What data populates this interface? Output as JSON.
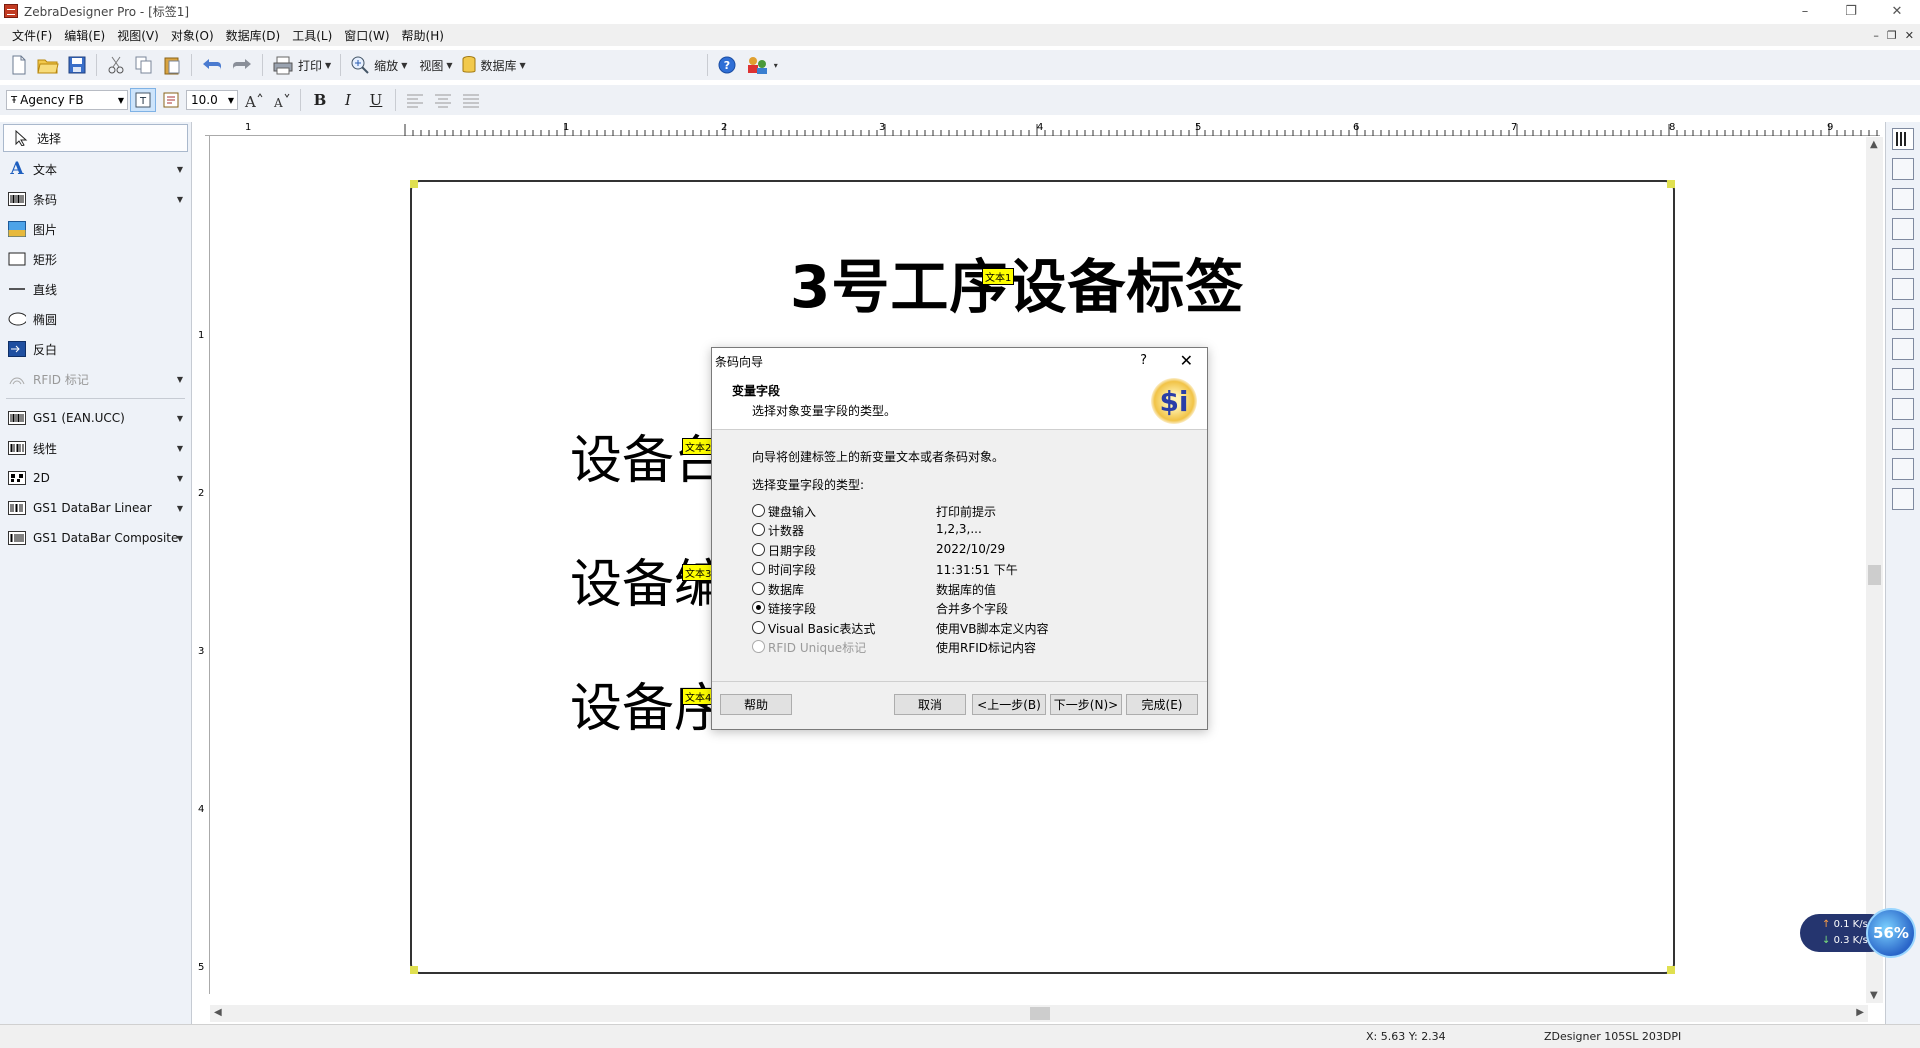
{
  "window": {
    "title": "ZebraDesigner Pro - [标签1]",
    "controls": [
      "–",
      "❐",
      "✕"
    ]
  },
  "menu": [
    "文件(F)",
    "编辑(E)",
    "视图(V)",
    "对象(O)",
    "数据库(D)",
    "工具(L)",
    "窗口(W)",
    "帮助(H)"
  ],
  "mdi_controls": [
    "–",
    "❐",
    "✕"
  ],
  "toolbar1": {
    "print": "打印",
    "zoom": "缩放",
    "view": "视图",
    "database": "数据库"
  },
  "toolbar2": {
    "font": "Agency FB",
    "size": "10.0",
    "bold": "B",
    "italic": "I",
    "underline": "U"
  },
  "left_tools": [
    {
      "label": "选择",
      "icon": "pointer-icon"
    },
    {
      "label": "文本",
      "icon": "text-icon"
    },
    {
      "label": "条码",
      "icon": "barcode-icon"
    },
    {
      "label": "图片",
      "icon": "picture-icon"
    },
    {
      "label": "矩形",
      "icon": "rectangle-icon"
    },
    {
      "label": "直线",
      "icon": "line-icon"
    },
    {
      "label": "椭圆",
      "icon": "ellipse-icon"
    },
    {
      "label": "反白",
      "icon": "inverse-icon"
    },
    {
      "label": "RFID 标记",
      "icon": "rfid-icon"
    }
  ],
  "left_barcode_tools": [
    {
      "label": "GS1 (EAN.UCC)"
    },
    {
      "label": "线性"
    },
    {
      "label": "2D"
    },
    {
      "label": "GS1 DataBar Linear"
    },
    {
      "label": "GS1 DataBar Composite"
    }
  ],
  "ruler": {
    "h_numbers": [
      "1",
      "1",
      "2",
      "3",
      "4",
      "5",
      "6",
      "7",
      "8",
      "9"
    ],
    "v_numbers": [
      "1",
      "2",
      "3",
      "4",
      "5"
    ]
  },
  "label": {
    "title": "3号工序设备标签",
    "title_tag": "文本1",
    "fields": [
      {
        "text": "设备台",
        "tag": "文本2"
      },
      {
        "text": "设备编",
        "tag": "文本3"
      },
      {
        "text": "设备序",
        "tag": "文本4"
      }
    ]
  },
  "dialog": {
    "title": "条码向导",
    "help_q": "?",
    "close": "✕",
    "heading": "变量字段",
    "subheading": "选择对象变量字段的类型。",
    "logo": "$i",
    "intro": "向导将创建标签上的新变量文本或者条码对象。",
    "prompt": "选择变量字段的类型:",
    "options": [
      {
        "label": "键盘输入",
        "desc": "打印前提示"
      },
      {
        "label": "计数器",
        "desc": "1,2,3,..."
      },
      {
        "label": "日期字段",
        "desc": "2022/10/29"
      },
      {
        "label": "时间字段",
        "desc": "11:31:51 下午"
      },
      {
        "label": "数据库",
        "desc": "数据库的值"
      },
      {
        "label": "链接字段",
        "desc": "合并多个字段"
      },
      {
        "label": "Visual Basic表达式",
        "desc": "使用VB脚本定义内容"
      },
      {
        "label": "RFID Unique标记",
        "desc": "使用RFID标记内容"
      }
    ],
    "selected_index": 5,
    "buttons": {
      "help": "帮助",
      "cancel": "取消",
      "back": "<上一步(B)",
      "next": "下一步(N)>",
      "finish": "完成(E)"
    }
  },
  "statusbar": {
    "coords": "X: 5.63 Y: 2.34",
    "printer": "ZDesigner 105SL 203DPI"
  },
  "net_widget": {
    "up": "0.1 K/s",
    "down": "0.3 K/s",
    "percent": "56%"
  }
}
